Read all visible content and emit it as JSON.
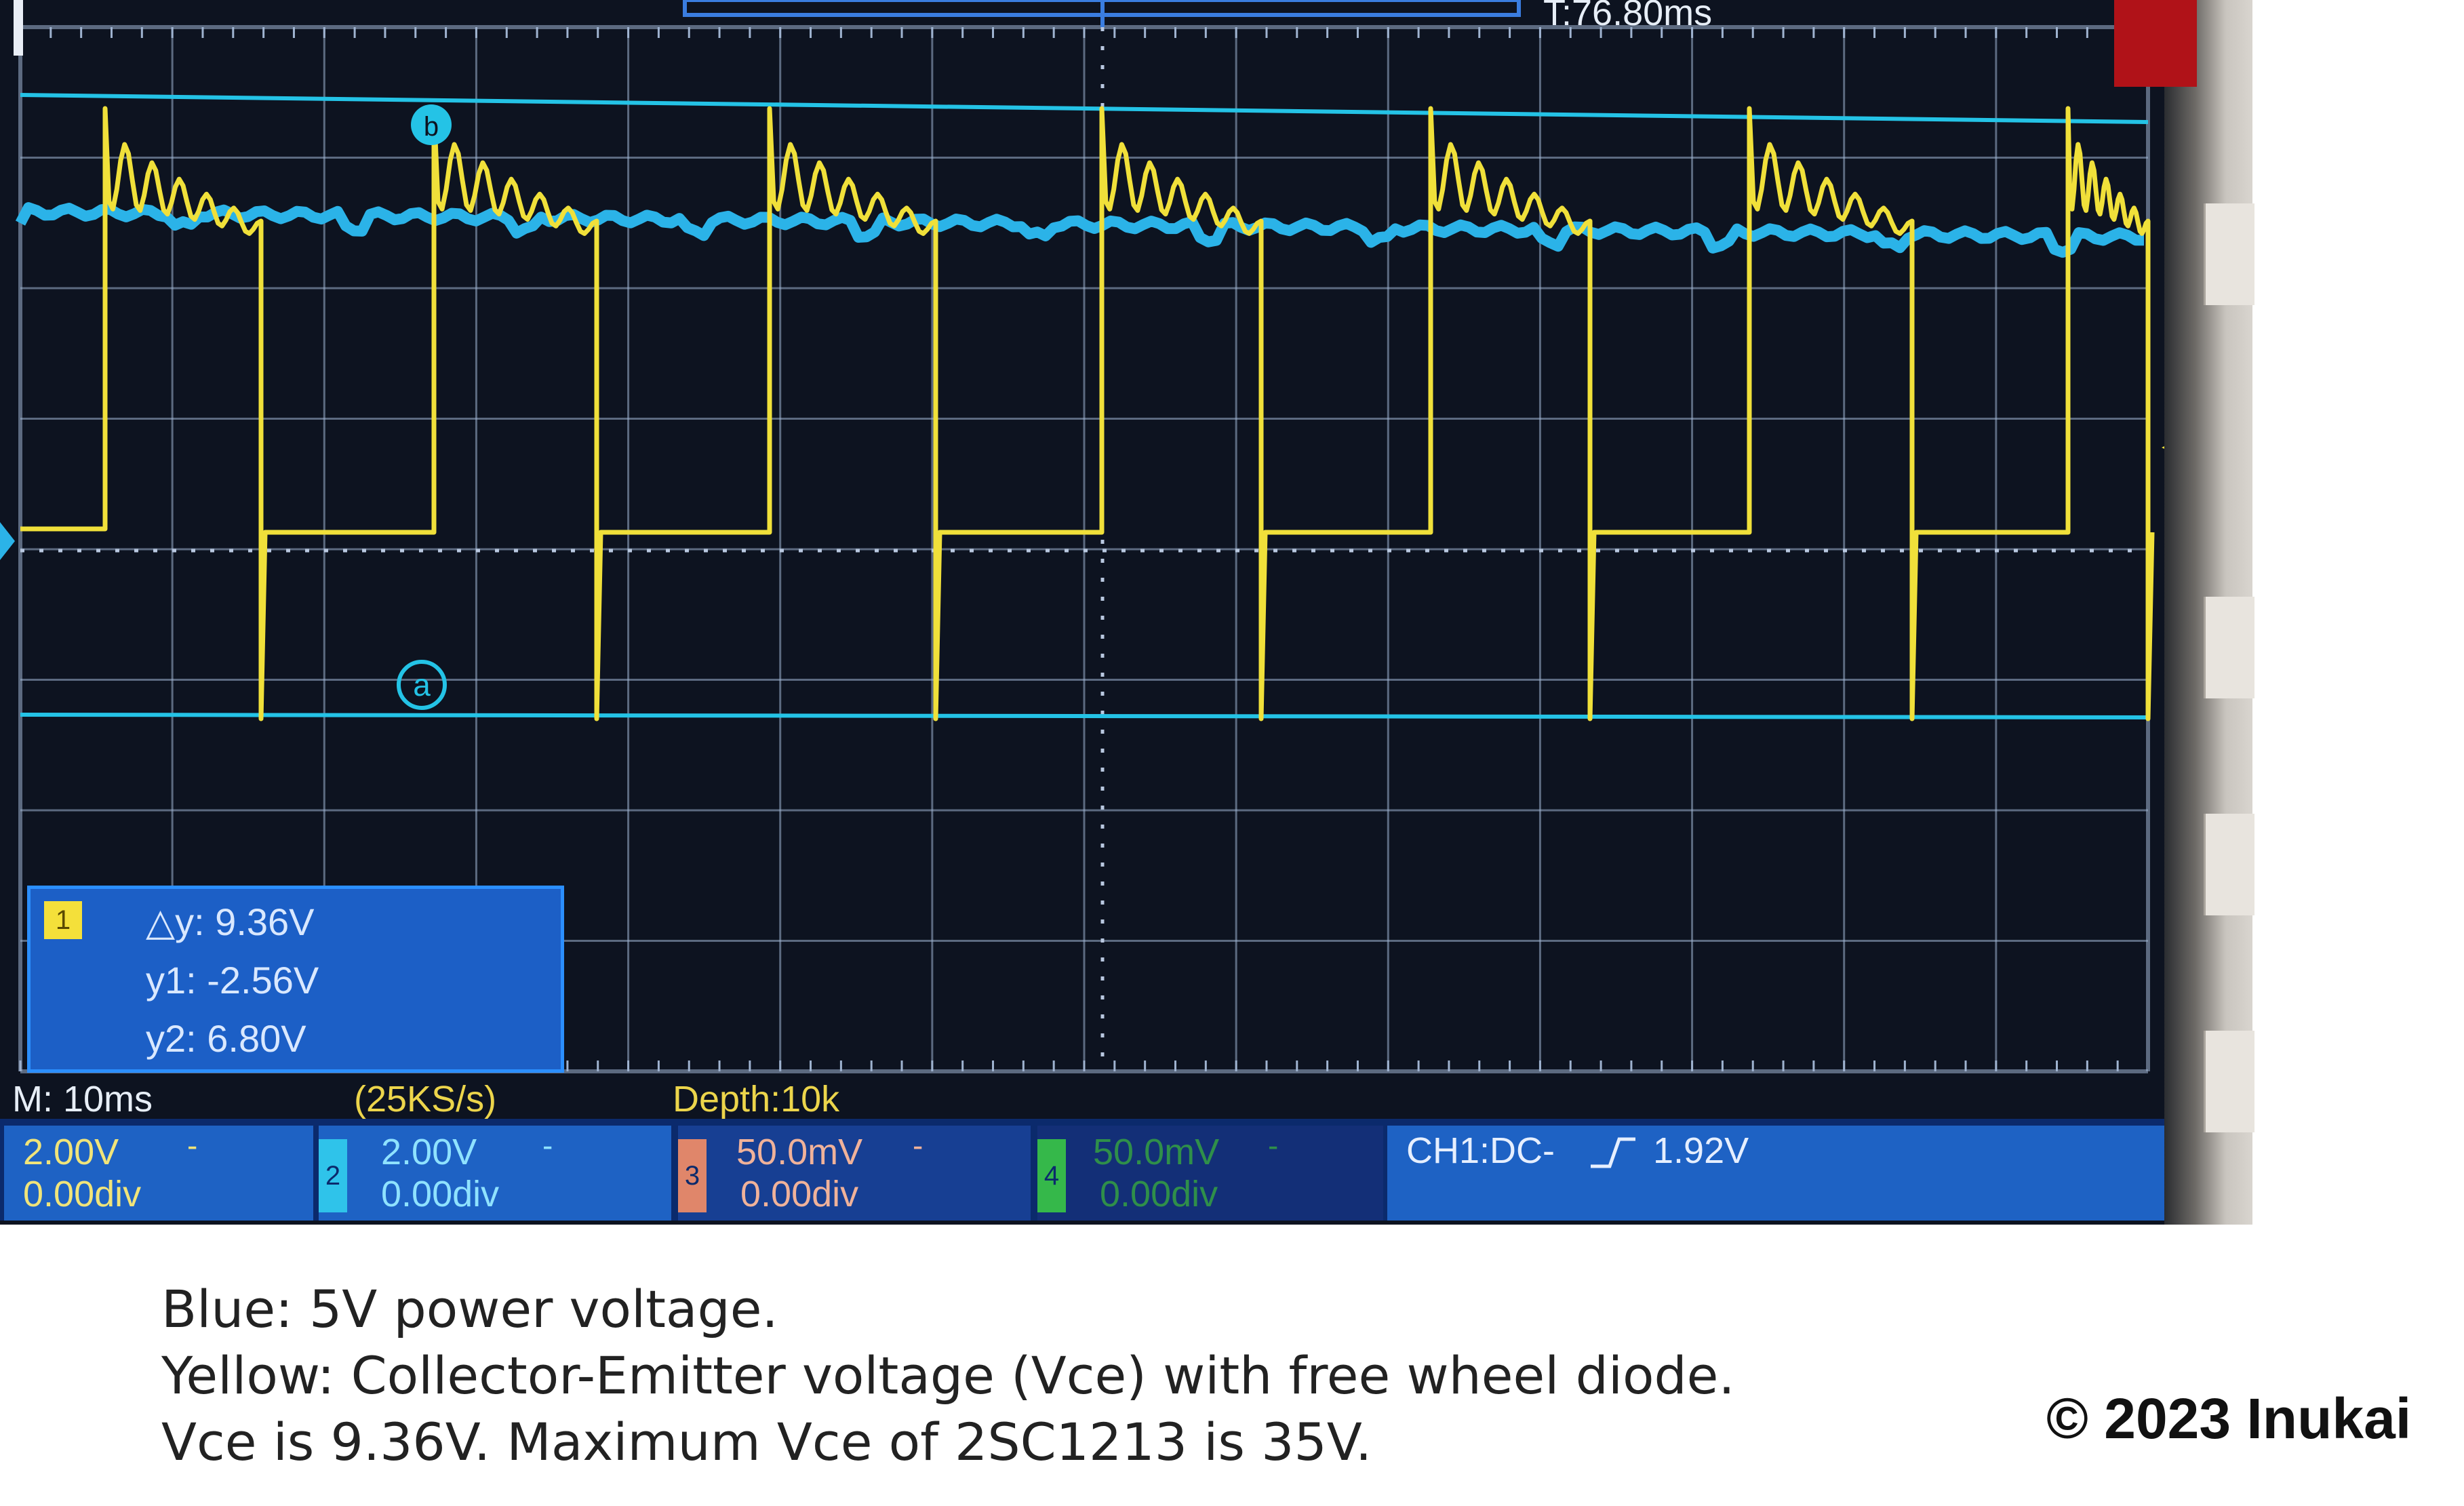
{
  "top_bar": {
    "time_readout": "T:76.80ms"
  },
  "screen": {
    "grid_color": "#9fb3d0",
    "yellow_trace_color": "#f0e03a",
    "blue_trace_color": "#2bb3e8",
    "cursor_line_color": "#24c3e6",
    "cursor_a_label": "a",
    "cursor_b_label": "b"
  },
  "cursor_box": {
    "channel_badge": "1",
    "delta_y": "△y: 9.36V",
    "y1": "y1: -2.56V",
    "y2": "y2: 6.80V"
  },
  "acquisition": {
    "timebase": "M: 10ms",
    "sample_rate": "(25KS/s)",
    "depth": "Depth:10k"
  },
  "channels": [
    {
      "num": "1",
      "volts": "2.00V",
      "offset": "0.00div",
      "badge_color": "#f4e03a"
    },
    {
      "num": "2",
      "volts": "2.00V",
      "offset": "0.00div",
      "badge_color": "#2fc3ea"
    },
    {
      "num": "3",
      "volts": "50.0mV",
      "offset": "0.00div",
      "badge_color": "#e0866a"
    },
    {
      "num": "4",
      "volts": "50.0mV",
      "offset": "0.00div",
      "badge_color": "#35b84a"
    }
  ],
  "trigger": {
    "label": "CH1:DC-",
    "level": "1.92V"
  },
  "caption": {
    "line1": "Blue:  5V power voltage.",
    "line2": "Yellow: Collector-Emitter voltage (Vce) with free wheel diode.",
    "line3": "Vce is 9.36V. Maximum Vce of 2SC1213 is 35V."
  },
  "copyright": "© 2023 Inukai"
}
